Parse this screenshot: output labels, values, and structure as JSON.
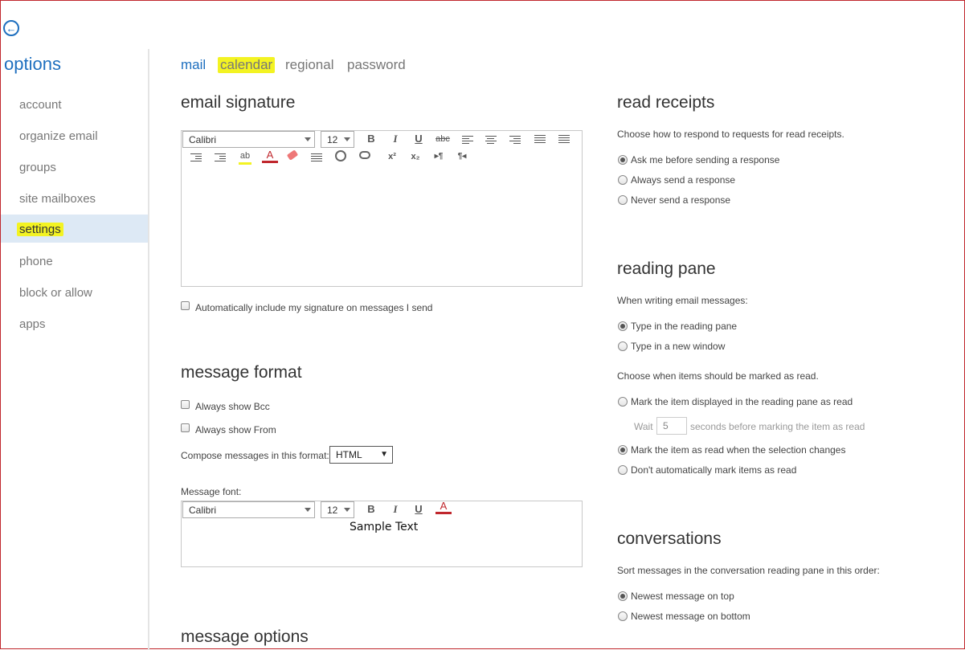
{
  "header": {
    "back_icon": "back-arrow-icon",
    "title": "options"
  },
  "sidebar": {
    "items": [
      {
        "label": "account",
        "selected": false
      },
      {
        "label": "organize email",
        "selected": false
      },
      {
        "label": "groups",
        "selected": false
      },
      {
        "label": "site mailboxes",
        "selected": false
      },
      {
        "label": "settings",
        "selected": true,
        "highlighted": true
      },
      {
        "label": "phone",
        "selected": false
      },
      {
        "label": "block or allow",
        "selected": false
      },
      {
        "label": "apps",
        "selected": false
      }
    ]
  },
  "tabs": [
    {
      "label": "mail",
      "active": true
    },
    {
      "label": "calendar",
      "highlighted": true
    },
    {
      "label": "regional"
    },
    {
      "label": "password"
    }
  ],
  "email_signature": {
    "heading": "email signature",
    "font": "Calibri",
    "size": "12",
    "toolbar_row1": [
      "bold-icon",
      "italic-icon",
      "underline-icon",
      "strikethrough-icon",
      "align-left-icon",
      "align-center-icon",
      "align-right-icon",
      "bullets-icon",
      "numbering-icon"
    ],
    "toolbar_row2": [
      "decrease-indent-icon",
      "increase-indent-icon",
      "highlight-icon",
      "font-color-icon",
      "clear-format-icon",
      "paragraph-spacing-icon",
      "insert-link-icon",
      "remove-link-icon",
      "superscript-icon",
      "subscript-icon",
      "ltr-icon",
      "rtl-icon"
    ],
    "glyphs": {
      "bold": "B",
      "italic": "I",
      "underline": "U",
      "strike": "abc",
      "font_color": "A",
      "superscript": "x²",
      "subscript": "x₂",
      "ltr": "▸¶",
      "rtl": "¶◂"
    },
    "auto_include_label": "Automatically include my signature on messages I send"
  },
  "message_format": {
    "heading": "message format",
    "always_bcc": "Always show Bcc",
    "always_from": "Always show From",
    "compose_label": "Compose messages in this format:",
    "compose_value": "HTML",
    "font_label": "Message font:",
    "font": "Calibri",
    "size": "12",
    "sample": "Sample Text"
  },
  "message_options": {
    "heading": "message options"
  },
  "read_receipts": {
    "heading": "read receipts",
    "description": "Choose how to respond to requests for read receipts.",
    "options": [
      {
        "label": "Ask me before sending a response",
        "checked": true
      },
      {
        "label": "Always send a response",
        "checked": false
      },
      {
        "label": "Never send a response",
        "checked": false
      }
    ]
  },
  "reading_pane": {
    "heading": "reading pane",
    "writing_label": "When writing email messages:",
    "writing_options": [
      {
        "label": "Type in the reading pane",
        "checked": true
      },
      {
        "label": "Type in a new window",
        "checked": false
      }
    ],
    "mark_label": "Choose when items should be marked as read.",
    "mark_option_1": "Mark the item displayed in the reading pane as read",
    "wait_label": "Wait",
    "wait_value": "5",
    "wait_suffix": "seconds before marking the item as read",
    "mark_option_2": "Mark the item as read when the selection changes",
    "mark_option_3": "Don't automatically mark items as read"
  },
  "conversations": {
    "heading": "conversations",
    "description": "Sort messages in the conversation reading pane in this order:",
    "options": [
      {
        "label": "Newest message on top",
        "checked": true
      },
      {
        "label": "Newest message on bottom",
        "checked": false
      }
    ]
  },
  "colors": {
    "accent": "#1e6fbf",
    "highlight": "#f3f322",
    "font_red": "#c0272d"
  }
}
